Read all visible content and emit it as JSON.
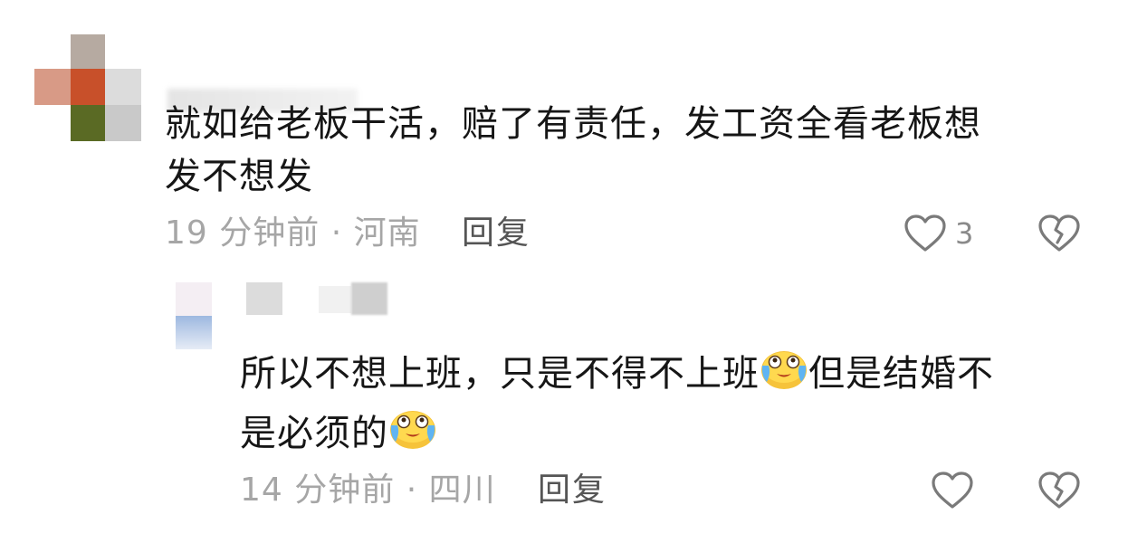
{
  "comments": [
    {
      "text_line1": "就如给老板干活，赔了有责任，发工资全看老板想",
      "text_line2": "发不想发",
      "time": "19 分钟前",
      "separator": "·",
      "location": "河南",
      "reply_label": "回复",
      "like_count": "3",
      "like_icon": "heart-outline-icon",
      "dislike_icon": "broken-heart-icon"
    },
    {
      "text_line1_a": "所以不想上班，只是不得不上班",
      "text_line1_b": "但是结婚不",
      "text_line2": "是必须的",
      "emoji_name": "crying-laughing-emoji",
      "time": "14 分钟前",
      "separator": "·",
      "location": "四川",
      "reply_label": "回复",
      "like_icon": "heart-outline-icon",
      "dislike_icon": "broken-heart-icon"
    }
  ],
  "colors": {
    "text": "#161616",
    "meta": "#a6a6a6",
    "icon": "#777777"
  }
}
